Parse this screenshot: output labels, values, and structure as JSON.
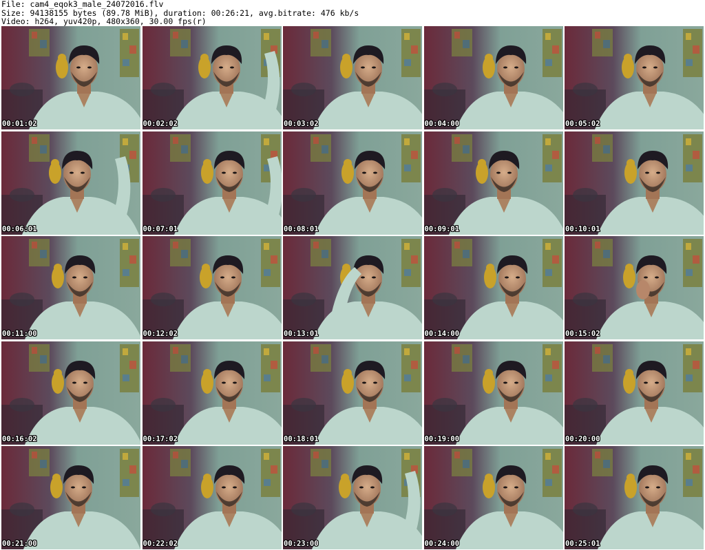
{
  "header": {
    "file_line": "File: cam4_eqok3_male_24072016.flv",
    "size_line": "Size: 94138155 bytes (89.78 MiB), duration: 00:26:21, avg.bitrate: 476 kb/s",
    "video_line": "Video: h264, yuv420p, 480x360, 30.00 fps(r)"
  },
  "colors": {
    "background": "#ffffff",
    "wall_left": "#6b2a3a",
    "wall_right": "#7fa096",
    "shirt": "#bcd6cc",
    "skin": "#c79a78",
    "hair": "#1e1a22",
    "poster": "#7a8040",
    "timestamp_fill": "#ffffff",
    "timestamp_outline": "#000000"
  },
  "thumbnails": [
    {
      "time": "00:01:02",
      "image": "webcam-frame"
    },
    {
      "time": "00:02:02",
      "image": "webcam-frame"
    },
    {
      "time": "00:03:02",
      "image": "webcam-frame"
    },
    {
      "time": "00:04:00",
      "image": "webcam-frame"
    },
    {
      "time": "00:05:02",
      "image": "webcam-frame"
    },
    {
      "time": "00:06:01",
      "image": "webcam-frame"
    },
    {
      "time": "00:07:01",
      "image": "webcam-frame"
    },
    {
      "time": "00:08:01",
      "image": "webcam-frame"
    },
    {
      "time": "00:09:01",
      "image": "webcam-frame"
    },
    {
      "time": "00:10:01",
      "image": "webcam-frame"
    },
    {
      "time": "00:11:00",
      "image": "webcam-frame"
    },
    {
      "time": "00:12:02",
      "image": "webcam-frame"
    },
    {
      "time": "00:13:01",
      "image": "webcam-frame"
    },
    {
      "time": "00:14:00",
      "image": "webcam-frame"
    },
    {
      "time": "00:15:02",
      "image": "webcam-frame"
    },
    {
      "time": "00:16:02",
      "image": "webcam-frame"
    },
    {
      "time": "00:17:02",
      "image": "webcam-frame"
    },
    {
      "time": "00:18:01",
      "image": "webcam-frame"
    },
    {
      "time": "00:19:00",
      "image": "webcam-frame"
    },
    {
      "time": "00:20:00",
      "image": "webcam-frame"
    },
    {
      "time": "00:21:00",
      "image": "webcam-frame"
    },
    {
      "time": "00:22:02",
      "image": "webcam-frame"
    },
    {
      "time": "00:23:00",
      "image": "webcam-frame"
    },
    {
      "time": "00:24:00",
      "image": "webcam-frame"
    },
    {
      "time": "00:25:01",
      "image": "webcam-frame"
    }
  ]
}
